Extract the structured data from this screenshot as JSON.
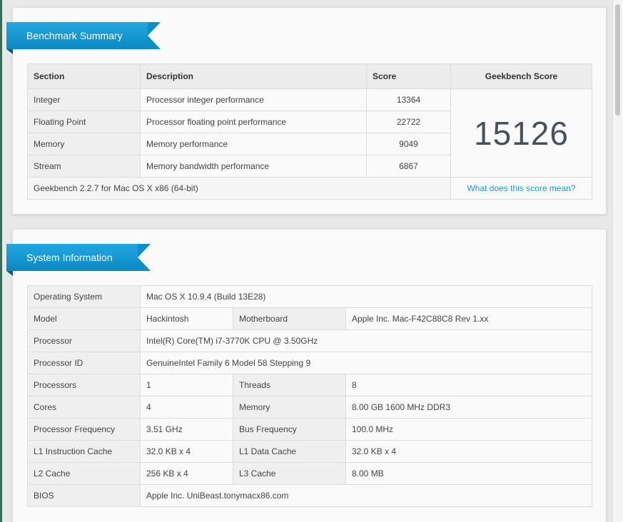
{
  "benchmark_summary": {
    "title": "Benchmark Summary",
    "headers": {
      "section": "Section",
      "description": "Description",
      "score": "Score",
      "geekbench_score": "Geekbench Score"
    },
    "rows": [
      {
        "section": "Integer",
        "description": "Processor integer performance",
        "score": "13364"
      },
      {
        "section": "Floating Point",
        "description": "Processor floating point performance",
        "score": "22722"
      },
      {
        "section": "Memory",
        "description": "Memory performance",
        "score": "9049"
      },
      {
        "section": "Stream",
        "description": "Memory bandwidth performance",
        "score": "6867"
      }
    ],
    "geekbench_score": "15126",
    "version": "Geekbench 2.2.7 for Mac OS X x86 (64-bit)",
    "score_link": "What does this score mean?"
  },
  "system_information": {
    "title": "System Information",
    "operating_system": {
      "label": "Operating System",
      "value": "Mac OS X 10.9.4 (Build 13E28)"
    },
    "model": {
      "label": "Model",
      "value": "Hackintosh"
    },
    "motherboard": {
      "label": "Motherboard",
      "value": "Apple Inc. Mac-F42C88C8 Rev 1.xx"
    },
    "processor": {
      "label": "Processor",
      "value": "Intel(R) Core(TM) i7-3770K CPU @ 3.50GHz"
    },
    "processor_id": {
      "label": "Processor ID",
      "value": "GenuineIntel Family 6 Model 58 Stepping 9"
    },
    "processors": {
      "label": "Processors",
      "value": "1"
    },
    "threads": {
      "label": "Threads",
      "value": "8"
    },
    "cores": {
      "label": "Cores",
      "value": "4"
    },
    "memory": {
      "label": "Memory",
      "value": "8.00 GB 1600 MHz DDR3"
    },
    "processor_frequency": {
      "label": "Processor Frequency",
      "value": "3.51 GHz"
    },
    "bus_frequency": {
      "label": "Bus Frequency",
      "value": "100.0 MHz"
    },
    "l1_instruction_cache": {
      "label": "L1 Instruction Cache",
      "value": "32.0 KB x 4"
    },
    "l1_data_cache": {
      "label": "L1 Data Cache",
      "value": "32.0 KB x 4"
    },
    "l2_cache": {
      "label": "L2 Cache",
      "value": "256 KB x 4"
    },
    "l3_cache": {
      "label": "L3 Cache",
      "value": "8.00 MB"
    },
    "bios": {
      "label": "BIOS",
      "value": "Apple Inc. UniBeast.tonymacx86.com"
    }
  }
}
